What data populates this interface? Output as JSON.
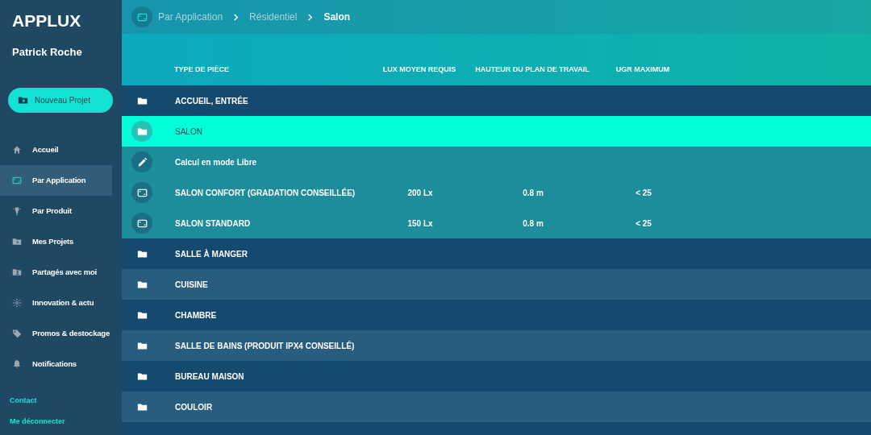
{
  "sidebar": {
    "app_name": "APPLUX",
    "user": "Patrick Roche",
    "new_project_button": "Nouveau Projet",
    "items": [
      {
        "label": "Accueil",
        "selected": false
      },
      {
        "label": "Par Application",
        "selected": true
      },
      {
        "label": "Par Produit",
        "selected": false
      },
      {
        "label": "Mes Projets",
        "selected": false
      },
      {
        "label": "Partagés avec moi",
        "selected": false
      },
      {
        "label": "Innovation & actu",
        "selected": false
      },
      {
        "label": "Promos & destockage",
        "selected": false
      },
      {
        "label": "Notifications",
        "selected": false
      }
    ],
    "links": [
      "Contact",
      "Me déconnecter"
    ]
  },
  "breadcrumb": [
    {
      "label": "Par Application",
      "current": false
    },
    {
      "label": "Résidentiel",
      "current": false
    },
    {
      "label": "Salon",
      "current": true
    }
  ],
  "table": {
    "columns": [
      "TYPE DE PIÈCE",
      "LUX MOYEN REQUIS",
      "HAUTEUR DU PLAN DE TRAVAIL",
      "UGR MAXIMUM"
    ],
    "rows": [
      {
        "kind": "folder",
        "name": "ACCUEIL, ENTRÉE",
        "selected": false
      },
      {
        "kind": "folder",
        "name": "SALON",
        "selected": true,
        "children": [
          {
            "kind": "mode",
            "name": "Calcul en mode Libre"
          },
          {
            "kind": "preset",
            "name": "SALON CONFORT (GRADATION CONSEILLÉE)",
            "lux": "200 Lx",
            "height": "0.8 m",
            "ugr": "< 25"
          },
          {
            "kind": "preset",
            "name": "SALON STANDARD",
            "lux": "150 Lx",
            "height": "0.8 m",
            "ugr": "< 25"
          }
        ]
      },
      {
        "kind": "folder",
        "name": "SALLE À MANGER",
        "selected": false
      },
      {
        "kind": "folder",
        "name": "CUISINE",
        "selected": false
      },
      {
        "kind": "folder",
        "name": "CHAMBRE",
        "selected": false
      },
      {
        "kind": "folder",
        "name": "SALLE DE BAINS (PRODUIT IPX4 CONSEILLÉ)",
        "selected": false
      },
      {
        "kind": "folder",
        "name": "BUREAU MAISON",
        "selected": false
      },
      {
        "kind": "folder",
        "name": "COULOIR",
        "selected": false
      }
    ]
  }
}
